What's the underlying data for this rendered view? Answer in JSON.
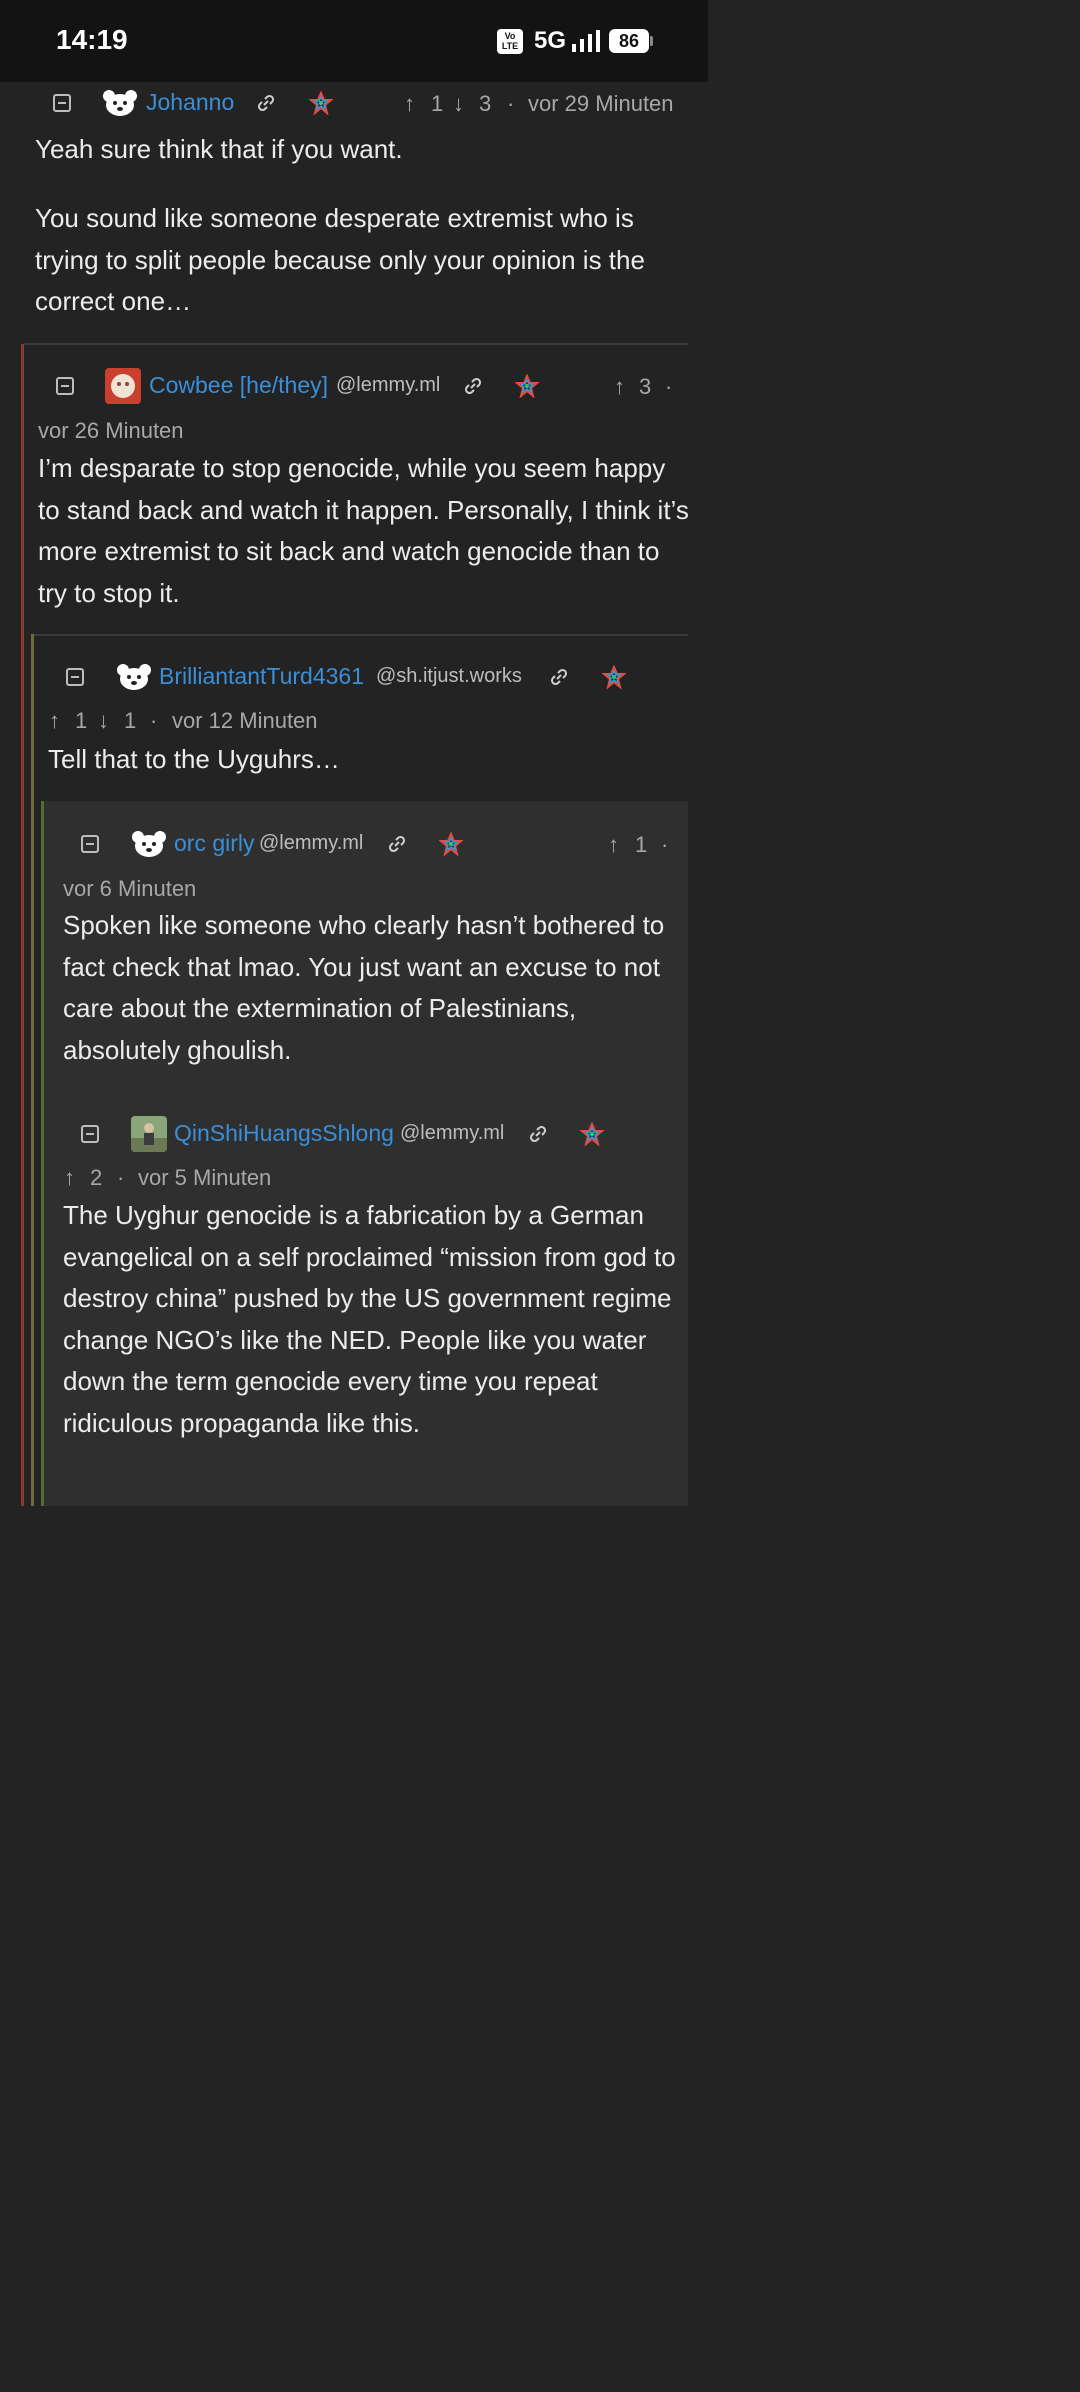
{
  "status_bar": {
    "time": "14:19",
    "volte": "Vo LTE",
    "network": "5G",
    "battery": "86"
  },
  "comments": [
    {
      "user": "Johanno",
      "instance": "",
      "upvotes": "1",
      "downvotes": "3",
      "time": "vor 29 Minuten",
      "paragraphs": [
        "Yeah sure think that if you want.",
        "You sound like someone desperate extremist who is trying to split people because only your opinion is the correct one…"
      ]
    },
    {
      "user": "Cowbee [he/they]",
      "instance": "@lemmy.ml",
      "upvotes": "3",
      "time": "vor 26 Minuten",
      "paragraphs": [
        "I’m desparate to stop genocide, while you seem happy to stand back and watch it happen. Personally, I think it’s more extremist to sit back and watch genocide than to try to stop it."
      ]
    },
    {
      "user": "BrilliantantTurd4361",
      "instance": "@sh.itjust.works",
      "upvotes": "1",
      "downvotes": "1",
      "time": "vor 12 Minuten",
      "paragraphs": [
        "Tell that to the Uyguhrs…"
      ]
    },
    {
      "user": "orc girly",
      "instance": "@lemmy.ml",
      "upvotes": "1",
      "time": "vor 6 Minuten",
      "paragraphs": [
        "Spoken like someone who clearly hasn’t bothered to fact check that lmao. You just want an excuse to not care about the extermination of Palestinians, absolutely ghoulish."
      ]
    },
    {
      "user": "QinShiHuangsShlong",
      "instance": "@lemmy.ml",
      "upvotes": "2",
      "time": "vor 5 Minuten",
      "paragraphs": [
        "The Uyghur genocide is a fabrication by a German evangelical on a self proclaimed “mission from god to destroy china” pushed by the US government regime change NGO’s like the NED. People like you water down the term genocide every time you repeat ridiculous propaganda like this."
      ]
    }
  ],
  "symbols": {
    "up": "↑",
    "down": "↓",
    "dot": "·"
  },
  "colors": {
    "username": "#3a8fd8",
    "thread_red": "#8b3a33",
    "thread_olive": "#6f6a3a",
    "thread_green": "#4f6b3a"
  }
}
